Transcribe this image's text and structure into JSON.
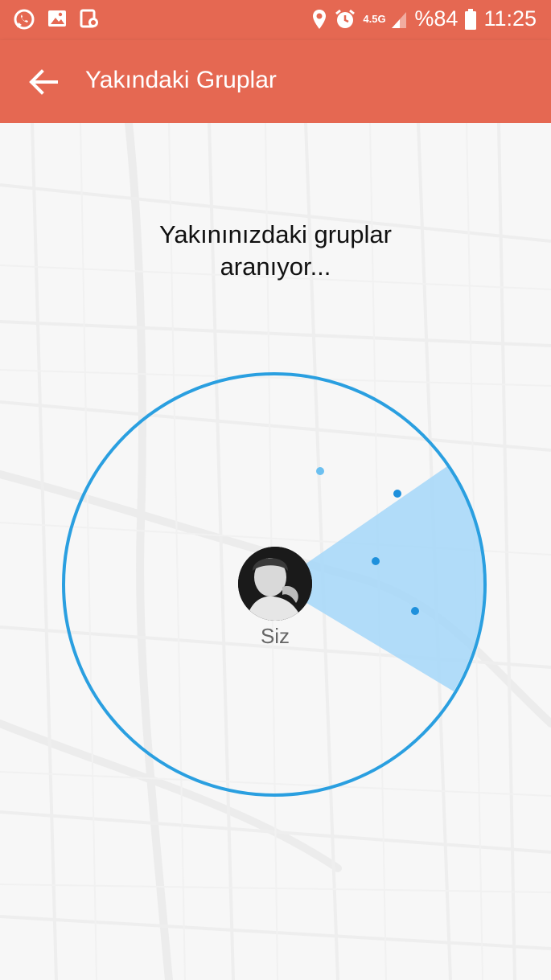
{
  "status_bar": {
    "network": "4.5G",
    "battery": "%84",
    "time": "11:25",
    "icons_left": [
      "whatsapp-icon",
      "gallery-icon",
      "calendar-icon"
    ],
    "icons_right": [
      "location-icon",
      "alarm-icon",
      "signal-icon",
      "battery-icon"
    ]
  },
  "app_bar": {
    "title": "Yakındaki Gruplar",
    "back_icon": "arrow-left-icon"
  },
  "main": {
    "search_line1": "Yakınınızdaki gruplar",
    "search_line2": "aranıyor...",
    "me_label": "Siz"
  },
  "colors": {
    "primary": "#e56852",
    "radar": "#2a9fe0",
    "sweep": "#9fd4f7"
  }
}
